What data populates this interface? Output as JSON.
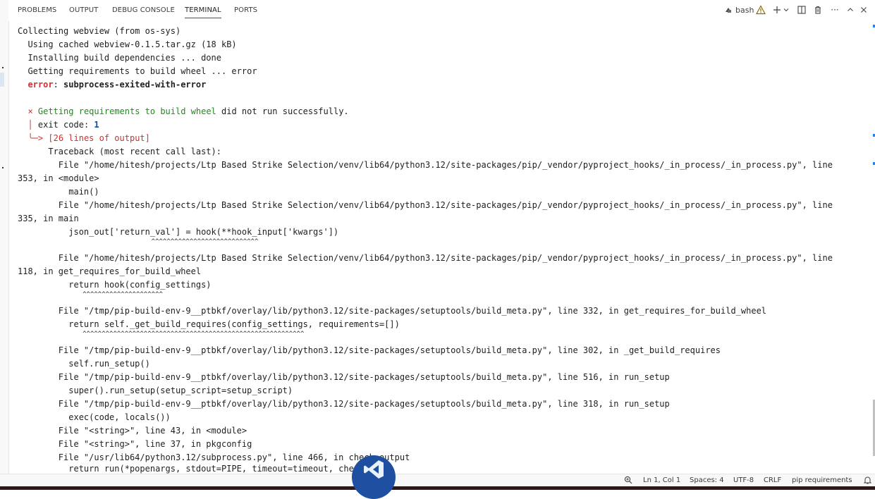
{
  "panel": {
    "tabs": [
      {
        "label": "PROBLEMS"
      },
      {
        "label": "OUTPUT"
      },
      {
        "label": "DEBUG CONSOLE"
      },
      {
        "label": "TERMINAL"
      },
      {
        "label": "PORTS"
      }
    ],
    "active_tab": "TERMINAL",
    "shell_label": "bash",
    "icons": [
      "bash-terminal-icon",
      "warning-icon",
      "add-terminal-icon",
      "chevron-down-icon",
      "split-terminal-icon",
      "trash-icon",
      "more-icon",
      "maximize-chevron-icon",
      "close-icon"
    ]
  },
  "terminal": {
    "lines": [
      "Collecting webview (from os-sys)",
      "  Using cached webview-0.1.5.tar.gz (18 kB)",
      "  Installing build dependencies ... done",
      "  Getting requirements to build wheel ... error",
      {
        "error_prefix": "error",
        "error_msg": "subprocess-exited-with-error"
      },
      "",
      {
        "x_mark": "×",
        "msg_green": "Getting requirements to build wheel",
        "msg_rest": " did not run successfully."
      },
      {
        "exit_label": "exit code: ",
        "exit_value": "1"
      },
      {
        "arrow": "╰─>",
        "output_note": "[26 lines of output]"
      },
      "      Traceback (most recent call last):",
      "        File \"/home/hitesh/projects/Ltp Based Strike Selection/venv/lib64/python3.12/site-packages/pip/_vendor/pyproject_hooks/_in_process/_in_process.py\", line",
      "353, in <module>",
      "          main()",
      "        File \"/home/hitesh/projects/Ltp Based Strike Selection/venv/lib64/python3.12/site-packages/pip/_vendor/pyproject_hooks/_in_process/_in_process.py\", line",
      "335, in main",
      "          json_out['return_val'] = hook(**hook_input['kwargs'])",
      "                                   ^^^^^^^^^^^^^^^^^^^^^^^^^^^^",
      "        File \"/home/hitesh/projects/Ltp Based Strike Selection/venv/lib64/python3.12/site-packages/pip/_vendor/pyproject_hooks/_in_process/_in_process.py\", line",
      "118, in get_requires_for_build_wheel",
      "          return hook(config_settings)",
      "                 ^^^^^^^^^^^^^^^^^^^^^",
      "        File \"/tmp/pip-build-env-9__ptbkf/overlay/lib/python3.12/site-packages/setuptools/build_meta.py\", line 332, in get_requires_for_build_wheel",
      "          return self._get_build_requires(config_settings, requirements=[])",
      "                 ^^^^^^^^^^^^^^^^^^^^^^^^^^^^^^^^^^^^^^^^^^^^^^^^^^^^^^^^^^",
      "        File \"/tmp/pip-build-env-9__ptbkf/overlay/lib/python3.12/site-packages/setuptools/build_meta.py\", line 302, in _get_build_requires",
      "          self.run_setup()",
      "        File \"/tmp/pip-build-env-9__ptbkf/overlay/lib/python3.12/site-packages/setuptools/build_meta.py\", line 516, in run_setup",
      "          super().run_setup(setup_script=setup_script)",
      "        File \"/tmp/pip-build-env-9__ptbkf/overlay/lib/python3.12/site-packages/setuptools/build_meta.py\", line 318, in run_setup",
      "          exec(code, locals())",
      "        File \"<string>\", line 43, in <module>",
      "        File \"<string>\", line 37, in pkgconfig",
      "        File \"/usr/lib64/python3.12/subprocess.py\", line 466, in check_output",
      "          return run(*popenargs, stdout=PIPE, timeout=timeout, check=True,"
    ]
  },
  "statusbar": {
    "zoom_icon": "zoom-icon",
    "position": "Ln 1, Col 1",
    "spaces": "Spaces: 4",
    "encoding": "UTF-8",
    "eol": "CRLF",
    "language": "pip requirements",
    "bell_icon": "bell-icon"
  },
  "colors": {
    "accent": "#005fb8",
    "error_red": "#cd3131",
    "success_green": "#218a1c",
    "number_blue": "#0451a5"
  }
}
